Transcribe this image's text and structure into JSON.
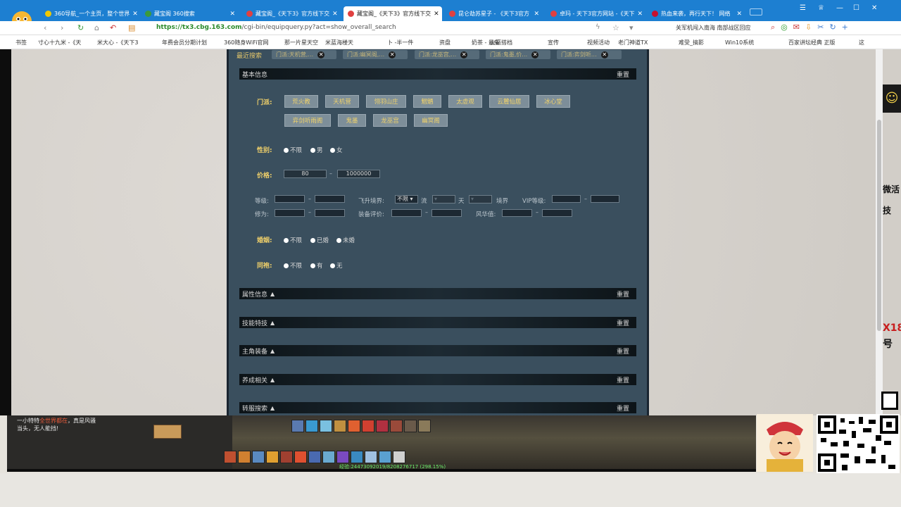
{
  "browser": {
    "tabs": [
      {
        "label": "360导航_一个主页，整个世界"
      },
      {
        "label": "藏宝阁 360搜索"
      },
      {
        "label": "藏宝阁_《天下3》官方线下交"
      },
      {
        "label": "藏宝阁_《天下3》官方线下交"
      },
      {
        "label": "昆仑劫苏星子 - 《天下3官方"
      },
      {
        "label": "卓玛 - 天下3官方网站 -《天下"
      },
      {
        "label": "热血来袭，再行天下！ 网络"
      }
    ],
    "url_host": "https://tx3.cbg.163.com",
    "url_path": "/cgi-bin/equipquery.py?act=show_overall_search",
    "addr_right": "关军机闯入南海 南部战区回应",
    "bookmarks": [
      "书签",
      "寸心十九米 -《天",
      "米大心 -《天下3",
      "年费会员分期计划",
      "360随身WiFi官网",
      "那一片星天空",
      "米蓝海楼天",
      "卜 -半一件",
      "资盘",
      "奶茶 - 最新",
      "火箭搭档",
      "宣传",
      "视频活动",
      "老门神道TX",
      "难受_搞影",
      "Win10系统",
      "百家讲坛经典 正版",
      "这"
    ]
  },
  "search": {
    "recent_label": "最近搜索",
    "recent_chips": [
      "门派:天机营,…",
      "门派:幽冥阁,…",
      "门派:龙巫宫,…",
      "门派:鬼墨,价…",
      "门派:弈剑听…"
    ],
    "basic_title": "基本信息",
    "reset": "重置",
    "school_label": "门派:",
    "schools_row1": [
      "荒火教",
      "天机营",
      "翎羽山庄",
      "魍魉",
      "太虚观",
      "云麓仙居",
      "冰心堂"
    ],
    "schools_row2": [
      "弈剑听雨阁",
      "鬼墨",
      "龙巫宫",
      "幽冥阁"
    ],
    "gender_label": "性别:",
    "gender_options": [
      "不限",
      "男",
      "女"
    ],
    "price_label": "价格:",
    "price_min": "80",
    "price_max": "1000000",
    "level_label": "等级:",
    "realm_label": "飞升境界:",
    "realm_select": "不限",
    "realm_unit1": "流",
    "realm_unit2": "天",
    "realm_unit3": "境界",
    "vip_label": "VIP等级:",
    "xiuwei_label": "修为:",
    "equip_label": "装备评价:",
    "fenghua_label": "风华值:",
    "marriage_label": "婚姻:",
    "marriage_options": [
      "不限",
      "已婚",
      "未婚"
    ],
    "tongpao_label": "同袍:",
    "tongpao_options": [
      "不限",
      "有",
      "无"
    ],
    "sections": [
      "属性信息",
      "技能特技",
      "主角装备",
      "养成相关",
      "转服搜索"
    ]
  },
  "game": {
    "chat_line1": "一小特特",
    "chat_red": "全世界都在",
    "chat_line1b": "，真是风骚",
    "chat_line2": "当头，无人能挡!",
    "exp": "经验:24473092019/8208276717 (298.15%)"
  },
  "right": {
    "t1": "微活",
    "t2": "技",
    "t3": "X18",
    "t4": "号"
  }
}
